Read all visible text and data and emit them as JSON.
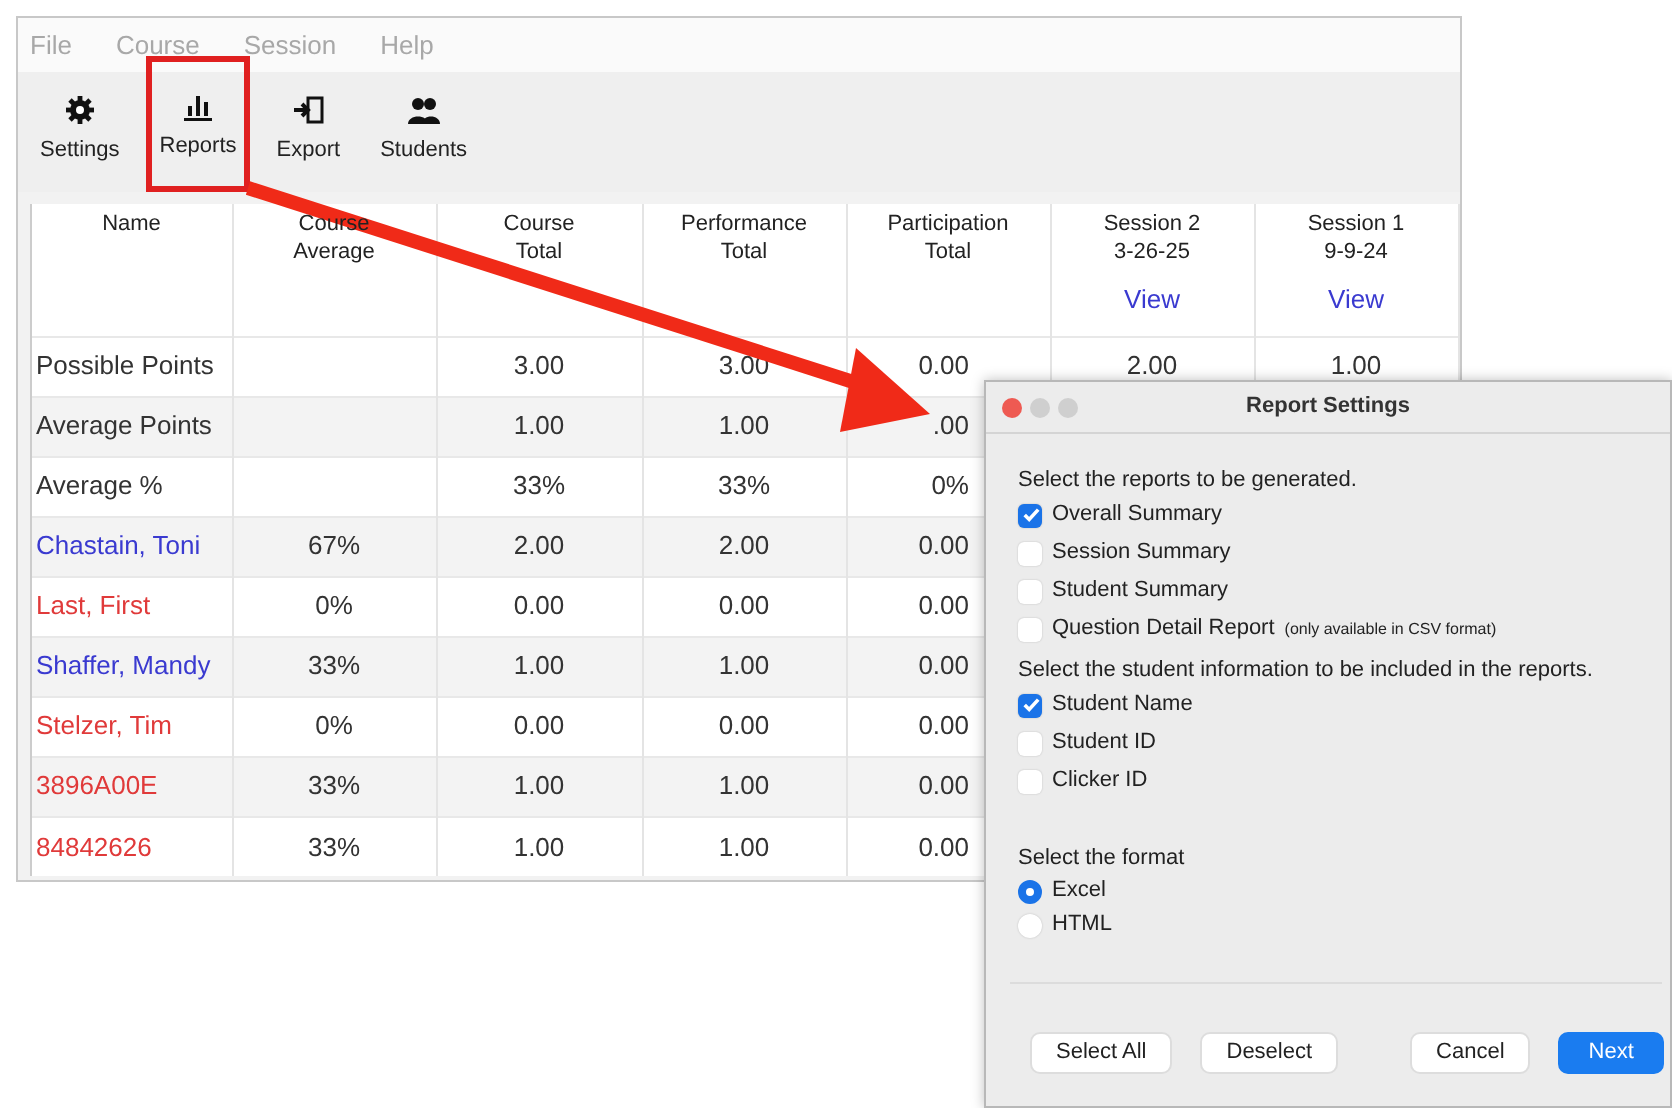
{
  "menu": [
    "File",
    "Course",
    "Session",
    "Help"
  ],
  "toolbar": [
    {
      "label": "Settings",
      "kind": "gear",
      "highlighted": false
    },
    {
      "label": "Reports",
      "kind": "chart",
      "highlighted": true
    },
    {
      "label": "Export",
      "kind": "export",
      "highlighted": false
    },
    {
      "label": "Students",
      "kind": "people",
      "highlighted": false
    }
  ],
  "table": {
    "columns": [
      {
        "heading": "Name"
      },
      {
        "heading": "Course\nAverage"
      },
      {
        "heading": "Course\nTotal"
      },
      {
        "heading": "Performance\nTotal"
      },
      {
        "heading": "Participation\nTotal"
      },
      {
        "heading": "Session 2\n3-26-25",
        "link": "View"
      },
      {
        "heading": "Session 1\n9-9-24",
        "link": "View"
      }
    ],
    "rows": [
      {
        "kind": "summary",
        "cells": [
          "Possible Points",
          "",
          "3.00",
          "3.00",
          "0.00",
          "2.00",
          "1.00"
        ]
      },
      {
        "kind": "summary",
        "cells": [
          "Average Points",
          "",
          "1.00",
          "1.00",
          ".00"
        ]
      },
      {
        "kind": "summary",
        "cells": [
          "Average %",
          "",
          "33%",
          "33%",
          "0%"
        ]
      },
      {
        "kind": "student",
        "color": "#3a3ad0",
        "cells": [
          "Chastain, Toni",
          "67%",
          "2.00",
          "2.00",
          "0.00"
        ]
      },
      {
        "kind": "student",
        "color": "#e03a3a",
        "cells": [
          "Last, First",
          "0%",
          "0.00",
          "0.00",
          "0.00"
        ]
      },
      {
        "kind": "student",
        "color": "#3a3ad0",
        "cells": [
          "Shaffer, Mandy",
          "33%",
          "1.00",
          "1.00",
          "0.00"
        ]
      },
      {
        "kind": "student",
        "color": "#e03a3a",
        "cells": [
          "Stelzer, Tim",
          "0%",
          "0.00",
          "0.00",
          "0.00"
        ]
      },
      {
        "kind": "student",
        "color": "#e03a3a",
        "cells": [
          "3896A00E",
          "33%",
          "1.00",
          "1.00",
          "0.00"
        ]
      },
      {
        "kind": "student",
        "color": "#e03a3a",
        "cells": [
          "84842626",
          "33%",
          "1.00",
          "1.00",
          "0.00"
        ]
      }
    ]
  },
  "dialog": {
    "title": "Report Settings",
    "sections": [
      {
        "heading": "Select the reports to be generated.",
        "kind": "checkbox",
        "options": [
          {
            "label": "Overall Summary",
            "checked": true
          },
          {
            "label": "Session Summary",
            "checked": false
          },
          {
            "label": "Student Summary",
            "checked": false
          },
          {
            "label": "Question Detail Report",
            "note": "(only available in CSV format)",
            "checked": false
          }
        ]
      },
      {
        "heading": "Select the student information to be included in the reports.",
        "kind": "checkbox",
        "options": [
          {
            "label": "Student Name",
            "checked": true
          },
          {
            "label": "Student ID",
            "checked": false
          },
          {
            "label": "Clicker ID",
            "checked": false
          }
        ]
      },
      {
        "heading": "Select the format",
        "kind": "radio",
        "options": [
          {
            "label": "Excel",
            "checked": true
          },
          {
            "label": "HTML",
            "checked": false
          }
        ]
      }
    ],
    "buttons": [
      {
        "label": "Select All",
        "primary": false
      },
      {
        "label": "Deselect",
        "primary": false
      },
      {
        "label": "Cancel",
        "primary": false
      },
      {
        "label": "Next",
        "primary": true
      }
    ]
  }
}
